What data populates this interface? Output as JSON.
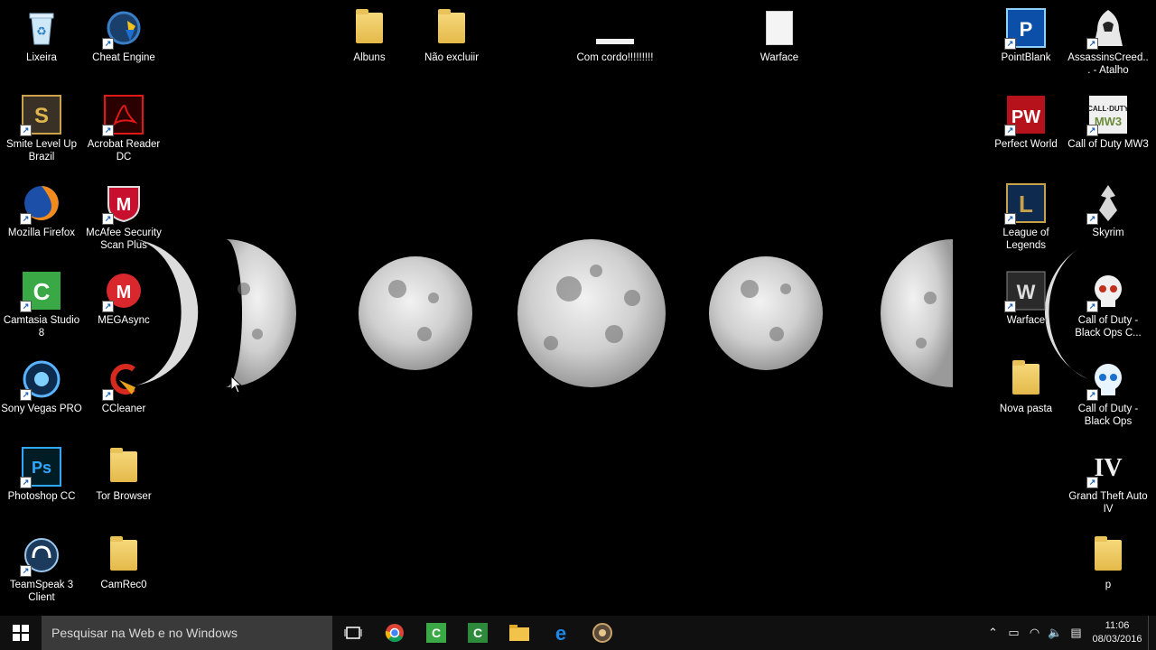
{
  "desktop": {
    "icons": {
      "lixeira": "Lixeira",
      "cheat_engine": "Cheat Engine",
      "smite": "Smite Level Up Brazil",
      "acrobat": "Acrobat Reader DC",
      "firefox": "Mozilla Firefox",
      "mcafee": "McAfee Security Scan Plus",
      "camtasia": "Camtasia Studio 8",
      "mega": "MEGAsync",
      "vegas": "Sony Vegas PRO",
      "ccleaner": "CCleaner",
      "photoshop": "Photoshop  CC",
      "tor": "Tor Browser",
      "teamspeak": "TeamSpeak 3 Client",
      "camrec": "CamRec0",
      "albuns": "Albuns",
      "nao_excluir": "Não excluiir",
      "com_cordo": "Com cordo!!!!!!!!!",
      "warface_doc": "Warface",
      "pointblank": "PointBlank",
      "assassins": "AssassinsCreed... - Atalho",
      "perfect_world": "Perfect World",
      "cod_mw3": "Call of Duty MW3",
      "lol": "League of Legends",
      "skyrim": "Skyrim",
      "warface": "Warface",
      "cod_bo_c": "Call of Duty - Black Ops C...",
      "nova_pasta": "Nova pasta",
      "cod_bo": "Call of Duty - Black Ops",
      "gta": "Grand Theft Auto IV",
      "p": "p"
    }
  },
  "taskbar": {
    "search_placeholder": "Pesquisar na Web e no Windows",
    "clock_time": "11:06",
    "clock_date": "08/03/2016"
  },
  "colors": {
    "taskbar_bg": "#101010",
    "search_bg": "#3a3a3a"
  }
}
